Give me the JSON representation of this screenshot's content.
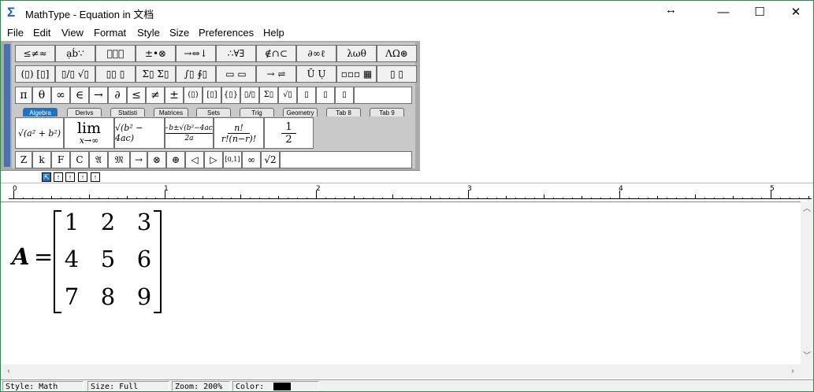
{
  "window": {
    "title": "MathType - Equation in 文档",
    "minimize": "—",
    "maximize": "☐",
    "close": "✕"
  },
  "menu": [
    "File",
    "Edit",
    "View",
    "Format",
    "Style",
    "Size",
    "Preferences",
    "Help"
  ],
  "toolbar": {
    "row1": [
      "≤≠≈",
      "ạḃ∵",
      "⃰⃗⃖",
      "±•⊗",
      "→⇔↓",
      "∴∀∃",
      "∉∩⊂",
      "∂∞ℓ",
      "λωθ",
      "ΛΩ⊛"
    ],
    "row2": [
      "(▯) [▯]",
      "▯/▯ √▯",
      "▯▯ ▯",
      "Σ▯ Σ▯",
      "∫▯ ∮▯",
      "▭ ▭",
      "→ ⇌",
      "Ū Ụ",
      "▫▫▫ ▦",
      "▯ ▯"
    ],
    "symbols": [
      "π",
      "θ",
      "∞",
      "∈",
      "→",
      "∂",
      "≤",
      "≠",
      "±",
      "(▯)",
      "[▯]",
      "{▯}",
      "▯/▯",
      "Σ▯",
      "√▯",
      "▯",
      "▯",
      "▯"
    ]
  },
  "tabs": [
    "Algebra",
    "Derivs",
    "Statisti",
    "Matrices",
    "Sets",
    "Trig",
    "Geometry",
    "Tab 8",
    "Tab 9"
  ],
  "templates": {
    "t1": "√(a² + b²)",
    "t2_top": "lim",
    "t2_bottom": "x→∞",
    "t3": "√(b² − 4ac)",
    "t4_num": "−b±√(b²−4ac)",
    "t4_den": "2a",
    "t5_num": "n!",
    "t5_den": "r!(n−r)!",
    "t6_num": "1",
    "t6_den": "2"
  },
  "small_symbols": [
    "Z",
    "k",
    "F",
    "C",
    "𝔄",
    "𝔐",
    "→",
    "⊗",
    "⊕",
    "◁",
    "▷",
    "[0,1]",
    "∞",
    "√2"
  ],
  "nest": [
    "⇱",
    "↑",
    "↑",
    "↑",
    "↑"
  ],
  "ruler": [
    "0",
    "1",
    "2",
    "3",
    "4",
    "5"
  ],
  "equation": {
    "lhs": "A",
    "eq": "=",
    "matrix": [
      [
        "1",
        "2",
        "3"
      ],
      [
        "4",
        "5",
        "6"
      ],
      [
        "7",
        "8",
        "9"
      ]
    ]
  },
  "status": {
    "style": "Style: Math",
    "size": "Size: Full",
    "zoom": "Zoom: 200%",
    "color": "Color:"
  },
  "colors": {
    "accent": "#1a73c9",
    "swatch": "#000000"
  }
}
